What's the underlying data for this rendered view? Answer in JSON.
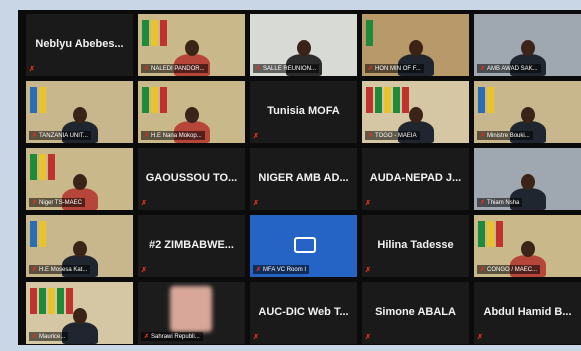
{
  "tiles": [
    {
      "name": "Neblyu Abebes...",
      "kind": "name"
    },
    {
      "name": "NALEDI PANDOR...",
      "kind": "video",
      "scene": "desk-flags",
      "active": true
    },
    {
      "name": "SALLE REUNION...",
      "kind": "video",
      "scene": "woman"
    },
    {
      "name": "HON MIN OF F...",
      "kind": "video",
      "scene": "office-flag"
    },
    {
      "name": "AMB AWAD SAK...",
      "kind": "video",
      "scene": "man-suit"
    },
    {
      "name": "TANZANIA UNIT...",
      "kind": "video",
      "scene": "man-flags"
    },
    {
      "name": "H.E Nana Mokop...",
      "kind": "video",
      "scene": "desk-flags"
    },
    {
      "name": "Tunisia MOFA",
      "kind": "name"
    },
    {
      "name": "TOGO - MAEIA",
      "kind": "video",
      "scene": "many-flags"
    },
    {
      "name": "Ministre Bouki...",
      "kind": "video",
      "scene": "man-flags"
    },
    {
      "name": "Niger TS-MAEC",
      "kind": "video",
      "scene": "desk-flags"
    },
    {
      "name": "GAOUSSOU TO...",
      "kind": "name"
    },
    {
      "name": "NIGER AMB AD...",
      "kind": "name"
    },
    {
      "name": "AUDA-NEPAD J...",
      "kind": "name"
    },
    {
      "name": "Thiam Nsha",
      "kind": "video",
      "scene": "man-suit"
    },
    {
      "name": "H.E Mosesa Kat...",
      "kind": "video",
      "scene": "man-flags"
    },
    {
      "name": "#2 ZIMBABWE...",
      "kind": "name"
    },
    {
      "name": "MFA VC Room I",
      "kind": "video",
      "scene": "blue"
    },
    {
      "name": "Hilina Tadesse",
      "kind": "name"
    },
    {
      "name": "CONGO / MAEC...",
      "kind": "video",
      "scene": "desk-flags"
    },
    {
      "name": "Maurice...",
      "kind": "video",
      "scene": "many-flags"
    },
    {
      "name": "Sahrawi Republi...",
      "kind": "video",
      "scene": "blur"
    },
    {
      "name": "AUC-DIC Web T...",
      "kind": "name"
    },
    {
      "name": "Simone ABALA",
      "kind": "name"
    },
    {
      "name": "Abdul Hamid B...",
      "kind": "name"
    }
  ],
  "colors": {
    "mic_off": "#e0321c",
    "active_speaker": "#f5e23a"
  },
  "icons": {
    "muted": "mic-muted-icon",
    "zoom_logo": "zoom-logo"
  }
}
